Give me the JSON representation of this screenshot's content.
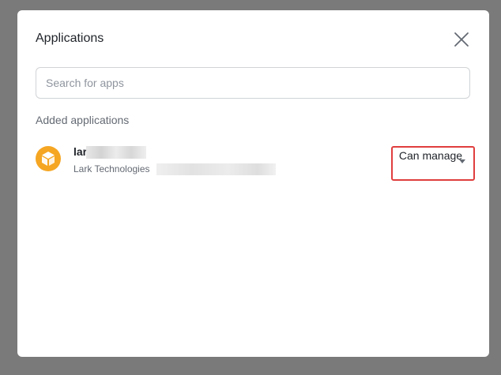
{
  "dialog": {
    "title": "Applications",
    "close_icon": "close-icon"
  },
  "search": {
    "placeholder": "Search for apps",
    "value": ""
  },
  "section": {
    "label": "Added applications"
  },
  "apps": [
    {
      "name": "lar",
      "org": "Lark Technologies",
      "icon": "cube-icon",
      "icon_color": "#f5a623",
      "permission": "Can manage"
    }
  ],
  "colors": {
    "highlight": "#e03e3e",
    "overlay": "#7a7a7a",
    "app_icon": "#f5a623"
  }
}
